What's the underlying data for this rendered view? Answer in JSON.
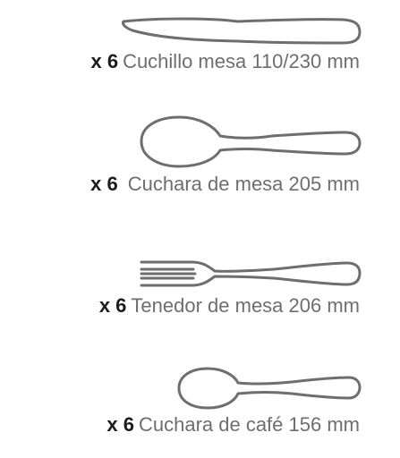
{
  "items": [
    {
      "icon": "knife-icon",
      "quantity": "x 6",
      "name": "Cuchillo mesa 110/230 mm"
    },
    {
      "icon": "spoon-icon",
      "quantity": "x 6",
      "name": "Cuchara de mesa 205 mm"
    },
    {
      "icon": "fork-icon",
      "quantity": "x 6",
      "name": "Tenedor de mesa 206 mm"
    },
    {
      "icon": "teaspoon-icon",
      "quantity": "x 6",
      "name": "Cuchara de café 156 mm"
    }
  ],
  "colors": {
    "outline": "#6e6e6e",
    "quantity_text": "#1c1c1c",
    "name_text": "#6e6e6e",
    "background": "#ffffff"
  }
}
